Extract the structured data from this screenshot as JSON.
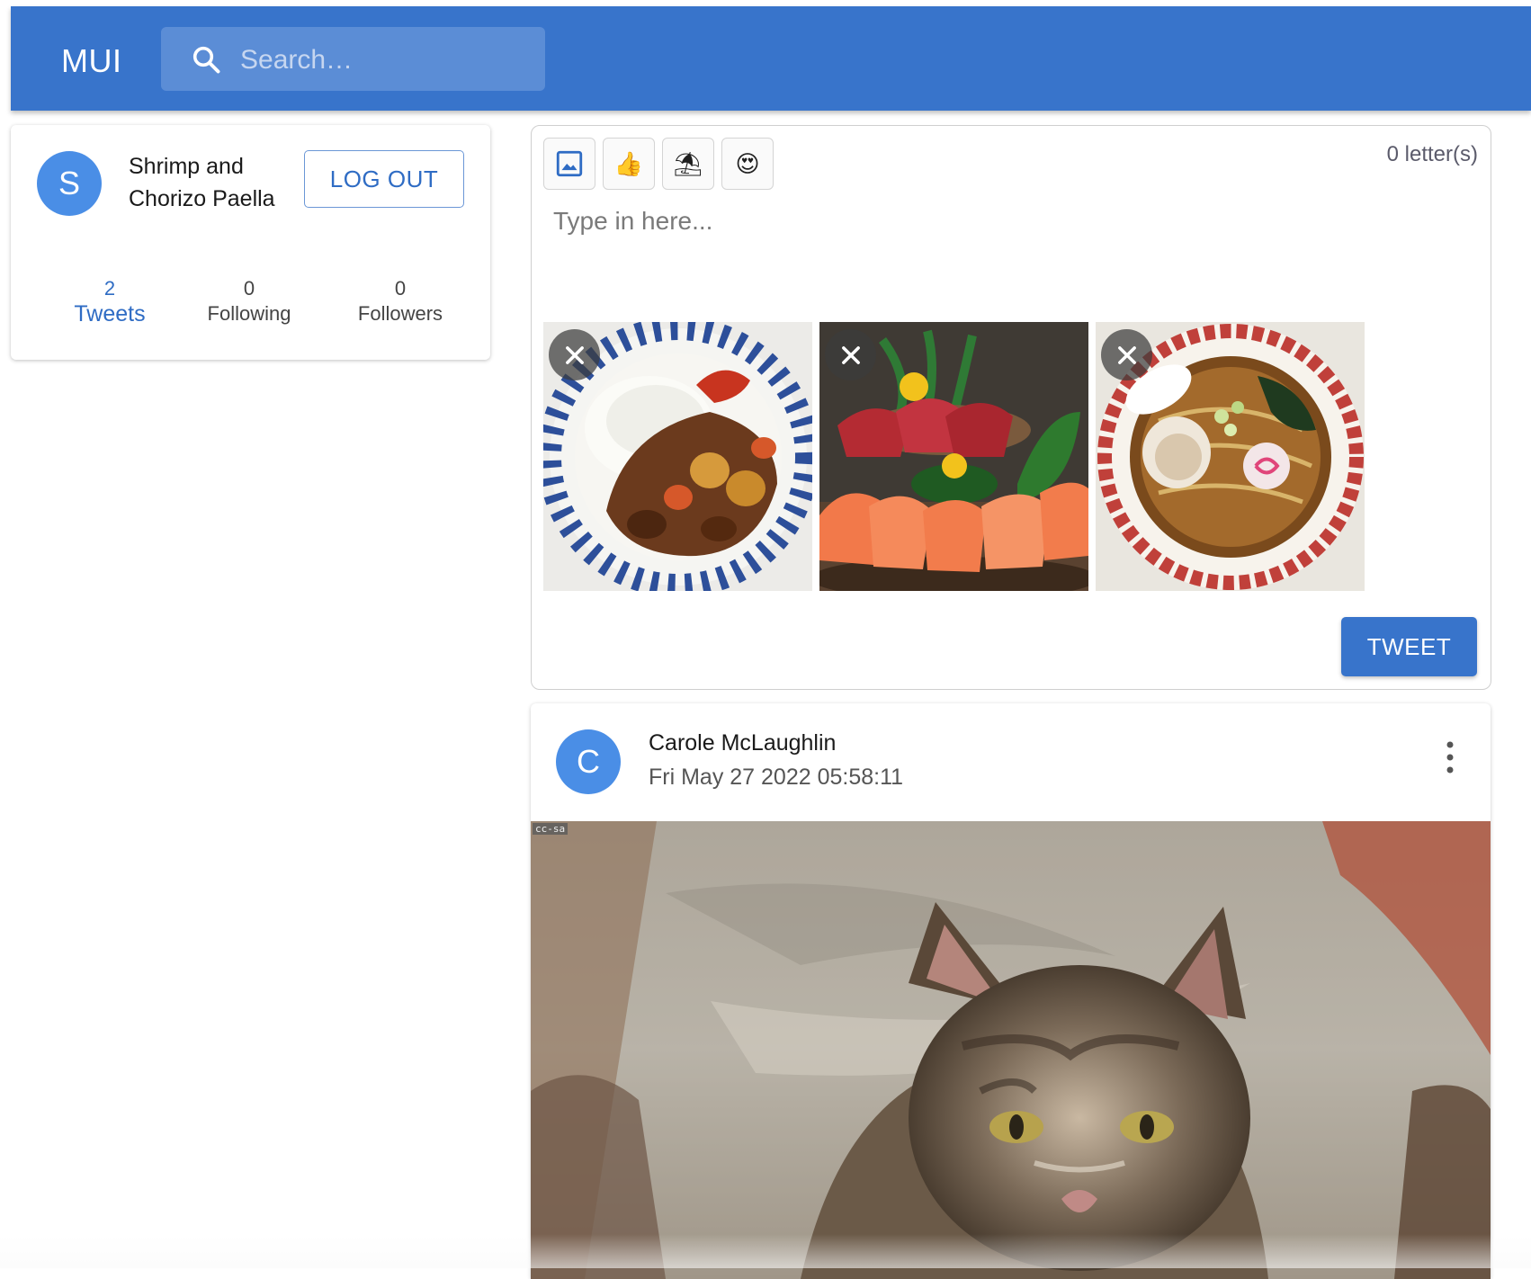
{
  "appbar": {
    "brand": "MUI",
    "search_placeholder": "Search…",
    "search_icon": "search-icon"
  },
  "profile": {
    "avatar_letter": "S",
    "name": "Shrimp and Chorizo Paella",
    "logout_label": "LOG OUT",
    "stats": [
      {
        "value": "2",
        "label": "Tweets",
        "active": true
      },
      {
        "value": "0",
        "label": "Following",
        "active": false
      },
      {
        "value": "0",
        "label": "Followers",
        "active": false
      }
    ]
  },
  "composer": {
    "tools": [
      {
        "icon": "image-icon",
        "glyph": ""
      },
      {
        "icon": "thumbs-up-icon",
        "glyph": "👍"
      },
      {
        "icon": "beach-umbrella-icon",
        "glyph": "⛱"
      },
      {
        "icon": "heart-eyes-icon",
        "glyph": "😍"
      }
    ],
    "letter_count": "0 letter(s)",
    "placeholder": "Type in here...",
    "attachments": [
      "curry-rice",
      "sashimi",
      "ramen"
    ],
    "tweet_label": "TWEET"
  },
  "post": {
    "avatar_letter": "C",
    "author": "Carole McLaughlin",
    "date": "Fri May 27 2022 05:58:11",
    "license": "cc-sa"
  },
  "colors": {
    "primary": "#3874cb",
    "avatar": "#4a8ee6",
    "search_bg": "#5b8dd6"
  }
}
